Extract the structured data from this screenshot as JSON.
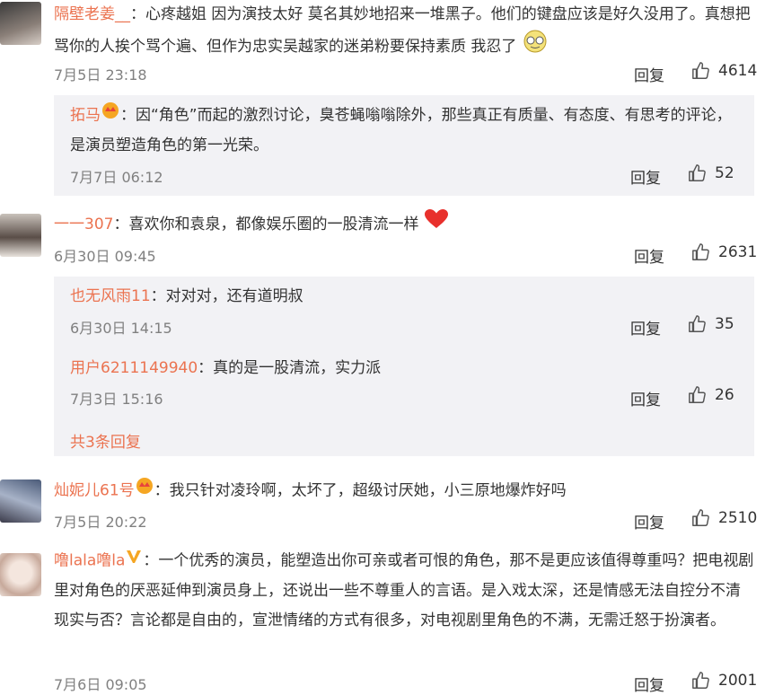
{
  "comments": [
    {
      "name": "隔壁老姜__",
      "text": "：心疼越姐 因为演技太好 莫名其妙地招来一堆黑子。他们的键盘应该是好久没用了。真想把骂你的人挨个骂个遍、但作为忠实吴越家的迷弟粉要保持素质 我忍了",
      "time": "7月5日 23:18",
      "reply": "回复",
      "likes": "4614",
      "subreplies": [
        {
          "name": "拓马",
          "text": "：因“角色”而起的激烈讨论，臭苍蝇嗡嗡除外，那些真正有质量、有态度、有思考的评论，是演员塑造角色的第一光荣。",
          "time": "7月7日 06:12",
          "reply": "回复",
          "likes": "52"
        }
      ]
    },
    {
      "name": "一一307",
      "text": "：喜欢你和袁泉，都像娱乐圈的一股清流一样",
      "time": "6月30日 09:45",
      "reply": "回复",
      "likes": "2631",
      "subreplies": [
        {
          "name": "也无风雨11",
          "text": "：对对对，还有道明叔",
          "time": "6月30日 14:15",
          "reply": "回复",
          "likes": "35"
        },
        {
          "name": "用户6211149940",
          "text": "：真的是一股清流，实力派",
          "time": "7月3日 15:16",
          "reply": "回复",
          "likes": "26"
        }
      ],
      "more_replies": "共3条回复"
    },
    {
      "name": "灿妮儿61号",
      "text": "：我只针对凌玲啊，太坏了，超级讨厌她，小三原地爆炸好吗",
      "time": "7月5日 20:22",
      "reply": "回复",
      "likes": "2510"
    },
    {
      "name": "噜lala噜la",
      "text": "：一个优秀的演员，能塑造出你可亲或者可恨的角色，那不是更应该值得尊重吗？把电视剧里对角色的厌恶延伸到演员身上，还说出一些不尊重人的言语。是入戏太深，还是情感无法自控分不清现实与否？言论都是自由的，宣泄情绪的方式有很多，对电视剧里角色的不满，无需迁怒于扮演者。",
      "time": "7月6日 09:05",
      "reply": "回复",
      "likes": "2001"
    }
  ],
  "colors": {
    "name": "#eb7350",
    "subbg": "#f2f2f5",
    "time": "#808080"
  },
  "icons": [
    "thumbs-up-icon",
    "heart-icon",
    "sweat-face-icon",
    "vip-badge-icon",
    "v-badge-icon"
  ]
}
